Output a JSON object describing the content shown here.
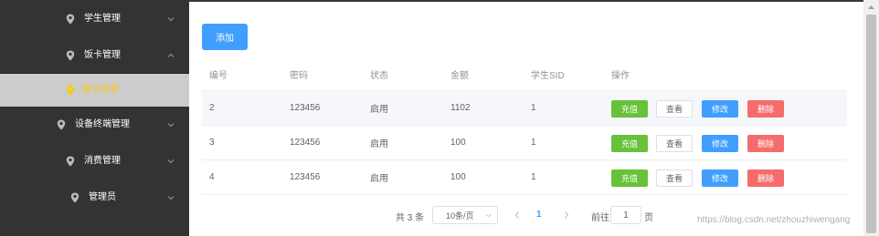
{
  "sidebar": {
    "items": [
      {
        "label": "学生管理",
        "icon": "location-pin-icon",
        "chevron": "down"
      },
      {
        "label": "饭卡管理",
        "icon": "location-pin-icon",
        "chevron": "up"
      },
      {
        "label": "饭卡信息",
        "icon": "location-pin-icon",
        "active": true
      },
      {
        "label": "设备终端管理",
        "icon": "location-pin-icon",
        "chevron": "down"
      },
      {
        "label": "消费管理",
        "icon": "location-pin-icon",
        "chevron": "down"
      },
      {
        "label": "管理员",
        "icon": "location-pin-icon",
        "chevron": "down"
      }
    ]
  },
  "toolbar": {
    "add_label": "添加"
  },
  "table": {
    "headers": [
      "编号",
      "密码",
      "状态",
      "金额",
      "学生SID",
      "操作"
    ],
    "rows": [
      {
        "id": "2",
        "password": "123456",
        "status": "启用",
        "amount": "1102",
        "sid": "1"
      },
      {
        "id": "3",
        "password": "123456",
        "status": "启用",
        "amount": "100",
        "sid": "1"
      },
      {
        "id": "4",
        "password": "123456",
        "status": "启用",
        "amount": "100",
        "sid": "1"
      }
    ],
    "actions": {
      "recharge": "充值",
      "view": "查看",
      "edit": "修改",
      "delete": "删除"
    }
  },
  "pagination": {
    "total_text": "共 3 条",
    "page_size": "10条/页",
    "current_page": "1",
    "goto_label": "前往",
    "goto_value": "1",
    "page_suffix": "页"
  },
  "watermark": "https://blog.csdn.net/zhouzhiwengang",
  "colors": {
    "sidebar_bg": "#333333",
    "active_bg": "#cccccc",
    "active_text": "#ffcc00",
    "primary": "#409eff",
    "success": "#67c23a",
    "danger": "#f56c6c"
  }
}
